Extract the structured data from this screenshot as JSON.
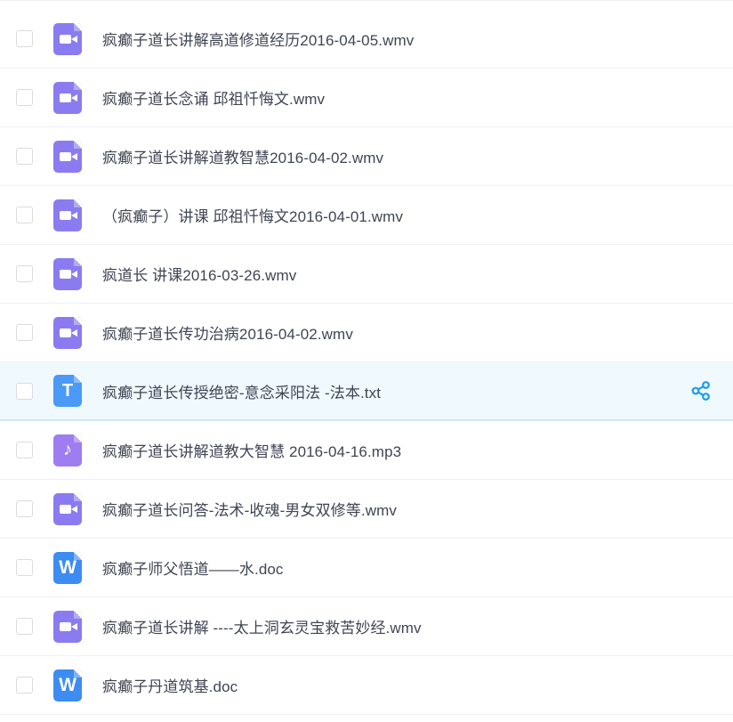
{
  "files": [
    {
      "name": "疯癫子道长讲解高道修道经历2016-04-05.wmv",
      "type": "video",
      "icon": "video-file-icon"
    },
    {
      "name": "疯癫子道长念诵 邱祖忏悔文.wmv",
      "type": "video",
      "icon": "video-file-icon"
    },
    {
      "name": "疯癫子道长讲解道教智慧2016-04-02.wmv",
      "type": "video",
      "icon": "video-file-icon"
    },
    {
      "name": "（疯癫子）讲课 邱祖忏悔文2016-04-01.wmv",
      "type": "video",
      "icon": "video-file-icon"
    },
    {
      "name": "疯道长 讲课2016-03-26.wmv",
      "type": "video",
      "icon": "video-file-icon"
    },
    {
      "name": "疯癫子道长传功治病2016-04-02.wmv",
      "type": "video",
      "icon": "video-file-icon"
    },
    {
      "name": "疯癫子道长传授绝密-意念采阳法 -法本.txt",
      "type": "text",
      "icon": "text-file-icon",
      "icon_letter": "T",
      "hovered": true
    },
    {
      "name": "疯癫子道长讲解道教大智慧 2016-04-16.mp3",
      "type": "audio",
      "icon": "audio-file-icon",
      "icon_letter": "♪"
    },
    {
      "name": "疯癫子道长问答-法术-收魂-男女双修等.wmv",
      "type": "video",
      "icon": "video-file-icon"
    },
    {
      "name": "疯癫子师父悟道——水.doc",
      "type": "doc",
      "icon": "word-file-icon",
      "icon_letter": "W"
    },
    {
      "name": "疯癫子道长讲解 ----太上洞玄灵宝救苦妙经.wmv",
      "type": "video",
      "icon": "video-file-icon"
    },
    {
      "name": "疯癫子丹道筑基.doc",
      "type": "doc",
      "icon": "word-file-icon",
      "icon_letter": "W"
    }
  ],
  "actions": {
    "share_icon": "share-icon"
  },
  "colors": {
    "video_icon": "#8a7cf0",
    "text_icon": "#4b9af7",
    "audio_icon": "#9e7df0",
    "doc_icon": "#3d8cf1",
    "hover_row_bg": "#f0f9fe",
    "share_icon": "#1a9cf0",
    "filename_text": "#3f4553"
  }
}
